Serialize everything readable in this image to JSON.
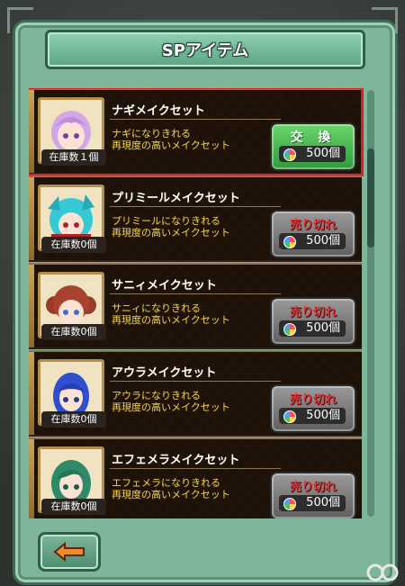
{
  "header": {
    "title": "SPアイテム"
  },
  "items": [
    {
      "name": "ナギメイクセット",
      "desc1": "ナギになりきれる",
      "desc2": "再現度の高いメイクセット",
      "stock": "在庫数１個",
      "button": "交 換",
      "price": "500個",
      "hair": "#d3a6e8",
      "state": "exchange"
    },
    {
      "name": "プリミールメイクセット",
      "desc1": "プリミールになりきれる",
      "desc2": "再現度の高いメイクセット",
      "stock": "在庫数0個",
      "button": "売り切れ",
      "price": "500個",
      "hair": "#35c9d6",
      "state": "sold"
    },
    {
      "name": "サニィメイクセット",
      "desc1": "サニィになりきれる",
      "desc2": "再現度の高いメイクセット",
      "stock": "在庫数0個",
      "button": "売り切れ",
      "price": "500個",
      "hair": "#9a3a2a",
      "state": "sold"
    },
    {
      "name": "アウラメイクセット",
      "desc1": "アウラになりきれる",
      "desc2": "再現度の高いメイクセット",
      "stock": "在庫数0個",
      "button": "売り切れ",
      "price": "500個",
      "hair": "#2f4fd0",
      "state": "sold"
    },
    {
      "name": "エフェメラメイクセット",
      "desc1": "エフェメラになりきれる",
      "desc2": "再現度の高いメイクセット",
      "stock": "在庫数0個",
      "button": "売り切れ",
      "price": "500個",
      "hair": "#2f8a6a",
      "state": "sold"
    }
  ],
  "colors": {
    "selected_outline": "#e0201d",
    "accent_green": "#2e9b3b",
    "sold_red": "#e23a3a"
  }
}
